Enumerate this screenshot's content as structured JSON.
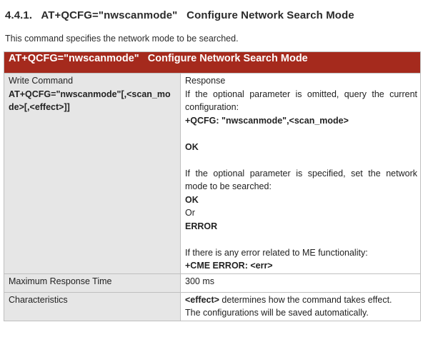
{
  "heading": {
    "number": "4.4.1.",
    "title": "AT+QCFG=\"nwscanmode\"   Configure Network Search Mode"
  },
  "intro": "This command specifies the network mode to be searched.",
  "table": {
    "title": "AT+QCFG=\"nwscanmode\"   Configure Network Search Mode",
    "write_command": {
      "label": "Write Command",
      "syntax_line1": "AT+QCFG=\"nwscanmode\"[,<scan_mo",
      "syntax_line2": "de>[,<effect>]]",
      "response_label": "Response",
      "omitted_text": "If the optional parameter is omitted, query the current configuration:",
      "query_response": "+QCFG: \"nwscanmode\",<scan_mode>",
      "ok_1": "OK",
      "specified_text": "If the optional parameter is specified, set the network mode to be searched:",
      "ok_2": "OK",
      "or": "Or",
      "error": "ERROR",
      "me_error_text": "If there is any error related to ME functionality:",
      "cme_error": "+CME ERROR: <err>"
    },
    "max_response_time": {
      "label": "Maximum Response Time",
      "value": "300 ms"
    },
    "characteristics": {
      "label": "Characteristics",
      "effect_tag": "<effect>",
      "effect_text": " determines how the command takes effect.",
      "saved_text": "The configurations will be saved automatically."
    }
  }
}
